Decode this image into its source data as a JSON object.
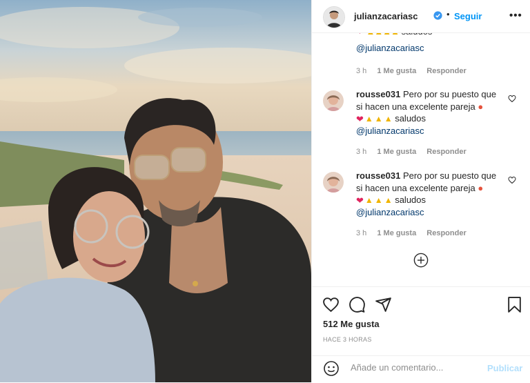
{
  "post": {
    "username": "julianzacariasc",
    "follow_label": "Seguir",
    "separator": "•",
    "more_label": "•••"
  },
  "comments": {
    "clipped": {
      "mention": "@julianzacariasc",
      "time": "3 h",
      "likes": "1 Me gusta",
      "reply": "Responder"
    },
    "items": [
      {
        "user": "rousse031",
        "text1": "Pero por su puesto que si hacen una excelente pareja",
        "text2": "saludos",
        "mention": "@julianzacariasc",
        "time": "3 h",
        "likes": "1 Me gusta",
        "reply": "Responder"
      },
      {
        "user": "rousse031",
        "text1": "Pero por su puesto que si hacen una excelente pareja",
        "text2": "saludos",
        "mention": "@julianzacariasc",
        "time": "3 h",
        "likes": "1 Me gusta",
        "reply": "Responder"
      }
    ]
  },
  "engagement": {
    "likes_label": "512 Me gusta",
    "time_ago": "HACE 3 HORAS"
  },
  "composer": {
    "placeholder": "Añade un comentario...",
    "publish_label": "Publicar"
  },
  "colors": {
    "accent": "#0095f6",
    "publish_disabled": "#b2dffc",
    "mention": "#00376b",
    "muted": "#8e8e8e"
  },
  "icons": [
    "verified-badge-icon",
    "more-options-icon",
    "heart-icon",
    "comment-icon",
    "share-icon",
    "bookmark-icon",
    "add-circle-icon",
    "emoji-icon"
  ]
}
